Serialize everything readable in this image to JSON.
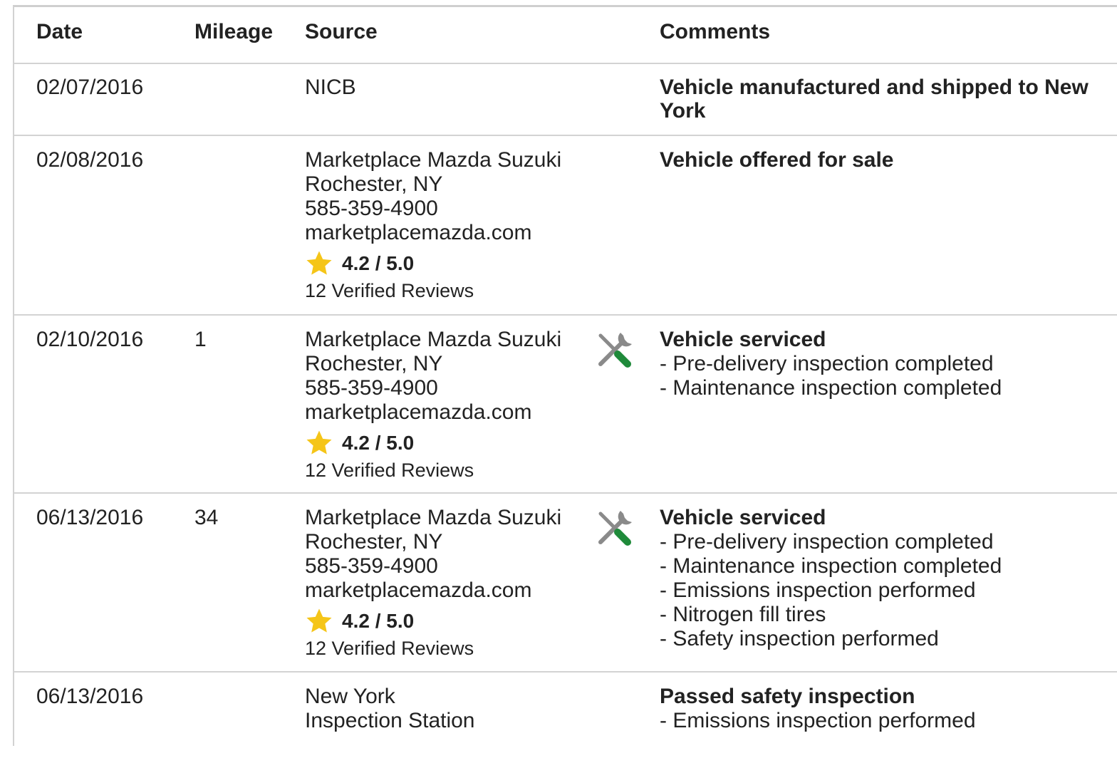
{
  "colors": {
    "star": "#f5c518",
    "wrench_handle": "#1f8a3a",
    "tool_gray": "#8a8a8a",
    "divider": "#d3d3d3"
  },
  "icons": {
    "star": "star-icon",
    "service": "service-tools-icon"
  },
  "table": {
    "headers": {
      "date": "Date",
      "mileage": "Mileage",
      "source": "Source",
      "comments": "Comments"
    },
    "rows": [
      {
        "date": "02/07/2016",
        "mileage": "",
        "source": {
          "lines": [
            "NICB"
          ]
        },
        "comment": {
          "title": "Vehicle manufactured and shipped to New York",
          "items": []
        }
      },
      {
        "date": "02/08/2016",
        "mileage": "",
        "source": {
          "lines": [
            "Marketplace Mazda Suzuki",
            "Rochester, NY",
            "585-359-4900",
            "marketplacemazda.com"
          ],
          "rating": "4.2 / 5.0",
          "reviews": "12 Verified Reviews"
        },
        "comment": {
          "title": "Vehicle offered for sale",
          "items": []
        }
      },
      {
        "date": "02/10/2016",
        "mileage": "1",
        "source": {
          "lines": [
            "Marketplace Mazda Suzuki",
            "Rochester, NY",
            "585-359-4900",
            "marketplacemazda.com"
          ],
          "rating": "4.2 / 5.0",
          "reviews": "12 Verified Reviews"
        },
        "service_icon": true,
        "comment": {
          "title": "Vehicle serviced",
          "items": [
            "Pre-delivery inspection completed",
            "Maintenance inspection completed"
          ]
        }
      },
      {
        "date": "06/13/2016",
        "mileage": "34",
        "source": {
          "lines": [
            "Marketplace Mazda Suzuki",
            "Rochester, NY",
            "585-359-4900",
            "marketplacemazda.com"
          ],
          "rating": "4.2 / 5.0",
          "reviews": "12 Verified Reviews"
        },
        "service_icon": true,
        "comment": {
          "title": "Vehicle serviced",
          "items": [
            "Pre-delivery inspection completed",
            "Maintenance inspection completed",
            "Emissions inspection performed",
            "Nitrogen fill tires",
            "Safety inspection performed"
          ]
        }
      },
      {
        "date": "06/13/2016",
        "mileage": "",
        "source": {
          "lines": [
            "New York",
            "Inspection Station"
          ]
        },
        "comment": {
          "title": "Passed safety inspection",
          "items": [
            "Emissions inspection performed"
          ]
        }
      }
    ]
  }
}
